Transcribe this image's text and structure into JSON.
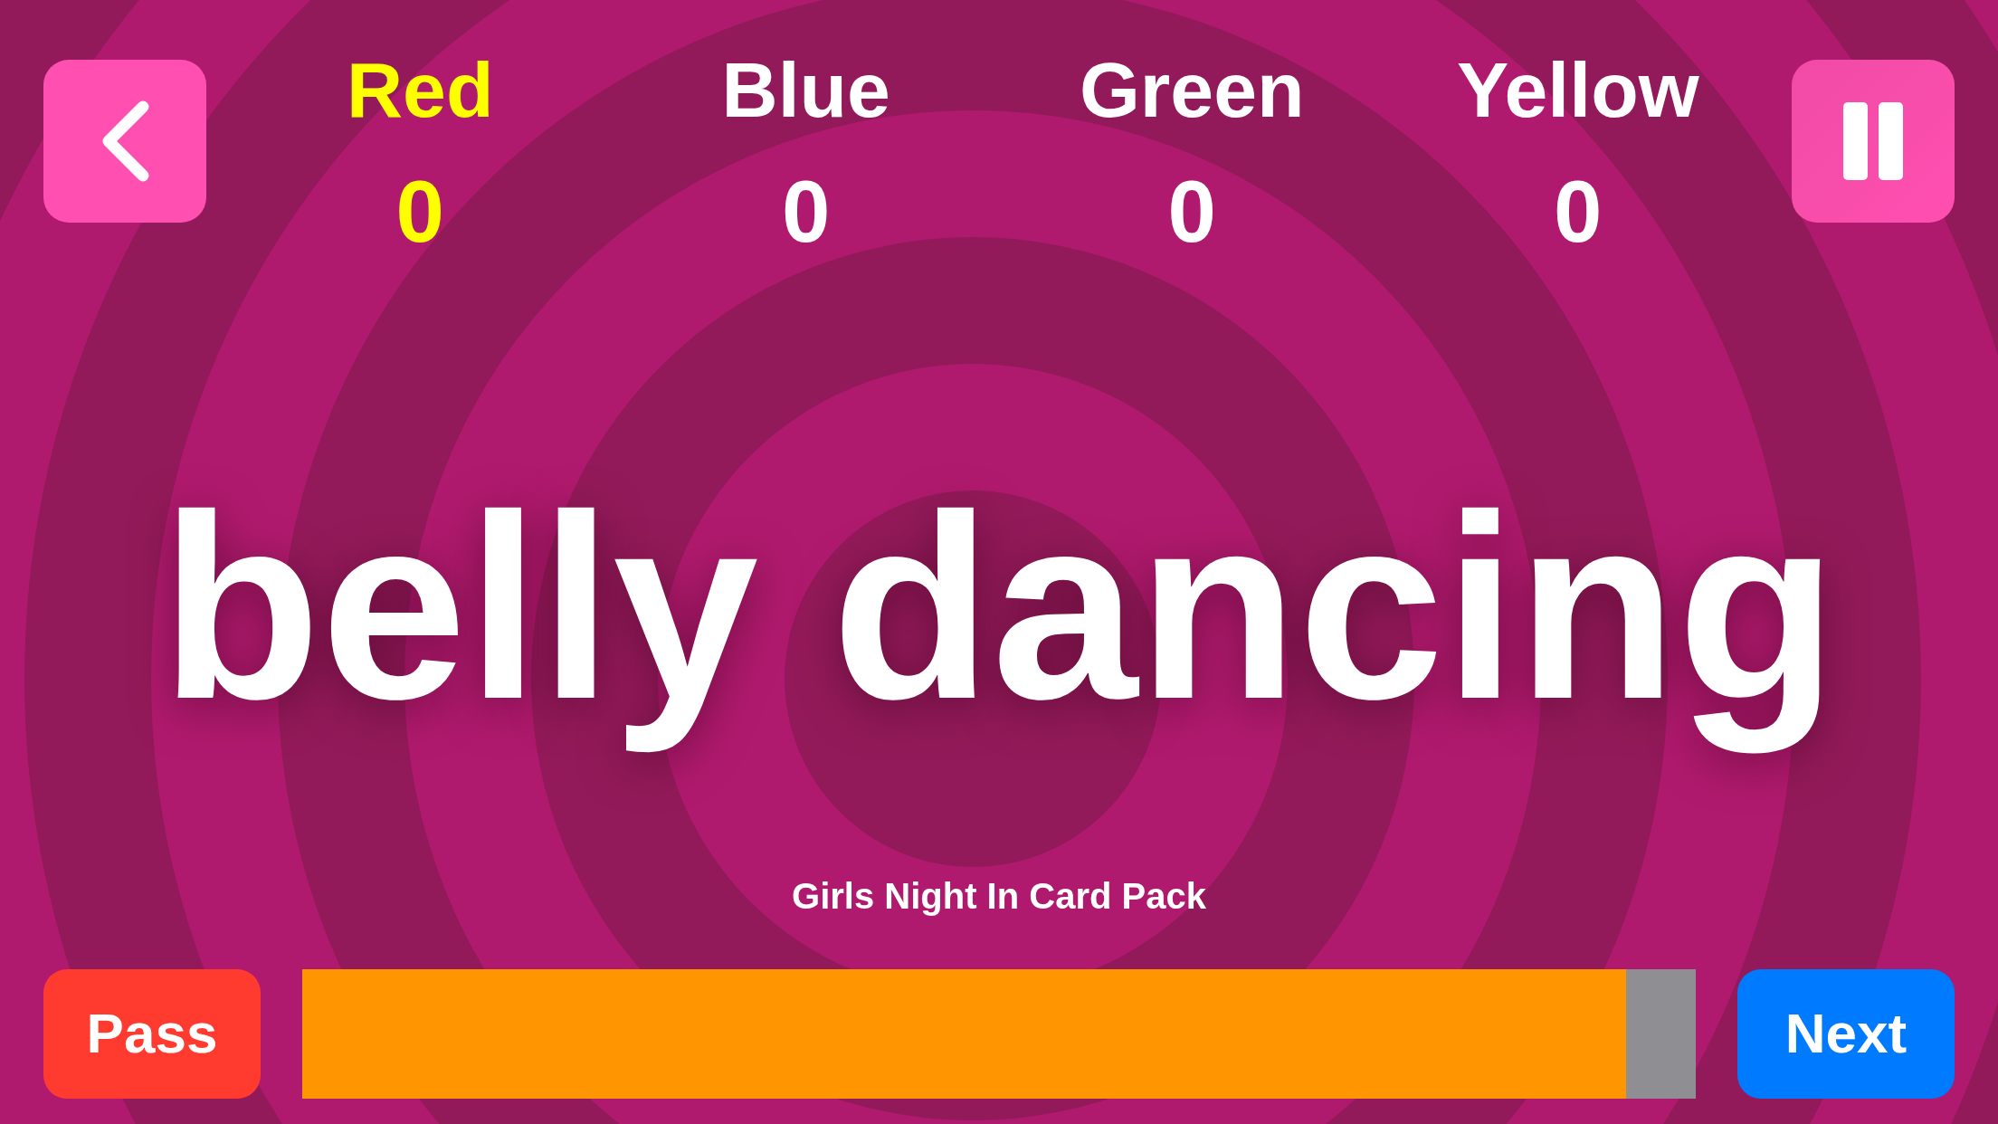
{
  "teams": [
    {
      "name": "Red",
      "score": "0",
      "selected": true
    },
    {
      "name": "Blue",
      "score": "0",
      "selected": false
    },
    {
      "name": "Green",
      "score": "0",
      "selected": false
    },
    {
      "name": "Yellow",
      "score": "0",
      "selected": false
    }
  ],
  "card": {
    "word": "belly dancing",
    "pack": "Girls Night In Card Pack"
  },
  "pass_button": {
    "label": "Pass"
  },
  "timer": {
    "level": 0.95
  },
  "next_button": {
    "label": "Next"
  }
}
